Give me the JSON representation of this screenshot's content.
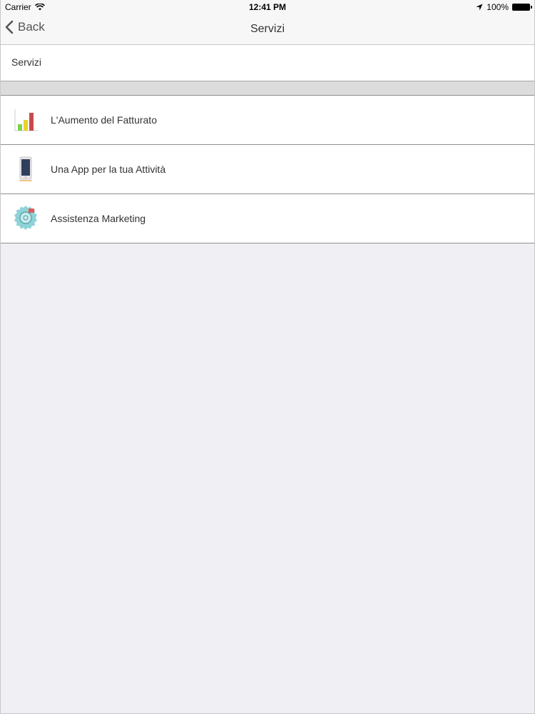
{
  "status_bar": {
    "carrier": "Carrier",
    "time": "12:41 PM",
    "battery": "100%"
  },
  "nav": {
    "back_label": "Back",
    "title": "Servizi"
  },
  "section": {
    "header": "Servizi"
  },
  "items": [
    {
      "label": "L'Aumento del Fatturato",
      "icon": "bar-chart-icon"
    },
    {
      "label": "Una App per la tua Attività",
      "icon": "smartphone-icon"
    },
    {
      "label": "Assistenza Marketing",
      "icon": "marketing-badge-icon"
    }
  ],
  "colors": {
    "background": "#efeff4",
    "separator": "#8e8e8e",
    "bar_green": "#7bd34a",
    "bar_yellow": "#e8d22f",
    "bar_red": "#c94a4a",
    "badge_teal": "#8fd3d8"
  }
}
